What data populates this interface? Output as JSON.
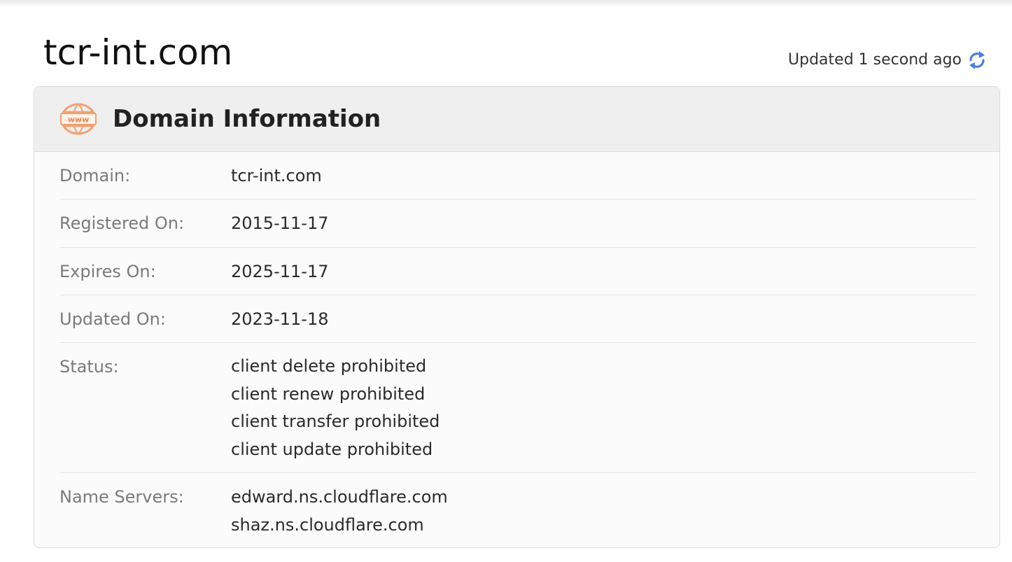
{
  "page": {
    "domain_heading": "tcr-int.com",
    "updated_text": "Updated 1 second ago",
    "refresh_icon": "refresh-icon",
    "refresh_color": "#4a7fd6"
  },
  "card": {
    "title": "Domain Information",
    "icon": "www-globe-icon",
    "icon_color": "#f0a070",
    "rows": {
      "domain": {
        "label": "Domain:",
        "value": "tcr-int.com"
      },
      "registered": {
        "label": "Registered On:",
        "value": "2015-11-17"
      },
      "expires": {
        "label": "Expires On:",
        "value": "2025-11-17"
      },
      "updated": {
        "label": "Updated On:",
        "value": "2023-11-18"
      },
      "status": {
        "label": "Status:",
        "values": [
          "client delete prohibited",
          "client renew prohibited",
          "client transfer prohibited",
          "client update prohibited"
        ]
      },
      "name_servers": {
        "label": "Name Servers:",
        "values": [
          "edward.ns.cloudflare.com",
          "shaz.ns.cloudflare.com"
        ]
      }
    }
  }
}
